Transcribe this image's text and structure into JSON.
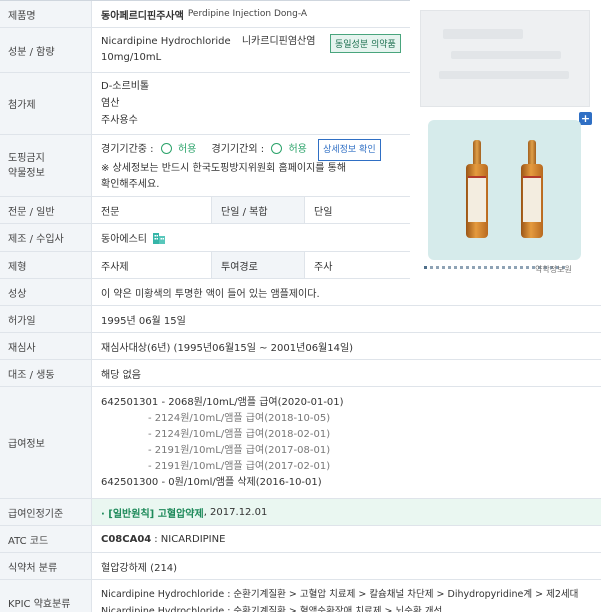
{
  "product": {
    "name_label": "제품명",
    "name_kr": "동아페르디핀주사액",
    "name_en": "Perdipine Injection Dong-A"
  },
  "ingredient": {
    "label": "성분 / 함량",
    "line1_en": "Nicardipine Hydrochloride",
    "line1_kr": "니카르디핀염산염",
    "line2": "10mg/10mL",
    "badge": "동일성분 의약품"
  },
  "additives": {
    "label": "첨가제",
    "items": [
      "D-소르비톨",
      "염산",
      "주사용수"
    ]
  },
  "doping": {
    "label_line1": "도핑금지",
    "label_line2": "약물정보",
    "in_comp": "경기기간중 :",
    "in_comp_value": "허용",
    "out_comp": "경기기간외 :",
    "out_comp_value": "허용",
    "detail_button": "상세정보 확인",
    "note1": "※ 상세정보는 반드시 한국도핑방지위원회 홈페이지를 통해",
    "note2": "확인해주세요."
  },
  "class": {
    "label": "전문 / 일반",
    "value": "전문",
    "sub_label": "단일 / 복합",
    "sub_value": "단일"
  },
  "maker": {
    "label": "제조 / 수입사",
    "value": "동아에스티",
    "icon": "building-icon"
  },
  "form": {
    "label": "제형",
    "value": "주사제",
    "sub_label": "투여경로",
    "sub_value": "주사"
  },
  "appearance": {
    "label": "성상",
    "value": "이 약은 미황색의 투명한 액이 들어 있는 앰플제이다."
  },
  "approval": {
    "label": "허가일",
    "value": "1995년 06월 15일"
  },
  "reexam": {
    "label": "재심사",
    "value": "재심사대상(6년) (1995년06월15일 ~ 2001년06월14일)"
  },
  "substitute": {
    "label": "대조 / 생동",
    "value": "해당 없음"
  },
  "reimbursement": {
    "label": "급여정보",
    "lines": [
      "642501301 - 2068원/10mL/앰플 급여(2020-01-01)",
      "- 2124원/10mL/앰플 급여(2018-10-05)",
      "- 2124원/10mL/앰플 급여(2018-02-01)",
      "- 2191원/10mL/앰플 급여(2017-08-01)",
      "- 2191원/10mL/앰플 급여(2017-02-01)",
      "642501300 - 0원/10ml/앰플 삭제(2016-10-01)"
    ]
  },
  "reimb_criteria": {
    "label": "급여인정기준",
    "prefix": "· [일반원칙] 고혈압약제",
    "date": ", 2017.12.01"
  },
  "atc": {
    "label": "ATC 코드",
    "code": "C08CA04",
    "name": ": NICARDIPINE"
  },
  "mfds_class": {
    "label": "식약처 분류",
    "value": "혈압강하제 (214)"
  },
  "kpic": {
    "label": "KPIC 약효분류",
    "lines": [
      "Nicardipine Hydrochloride : 순환기계질환 > 고혈압 치료제 > 칼슘채널 차단제 > Dihydropyridine계 > 제2세대",
      "Nicardipine Hydrochloride : 순환기계질환 > 혈액순환장애 치료제 > 뇌순환 개선"
    ]
  },
  "image_panel": {
    "plus_label": "+",
    "credit": "약학정보원"
  },
  "colors": {
    "header_bg": "#f2f5f8",
    "accent_blue": "#2f6fc4",
    "accent_green": "#2ba36a",
    "highlight_bg": "#eaf7f1"
  }
}
